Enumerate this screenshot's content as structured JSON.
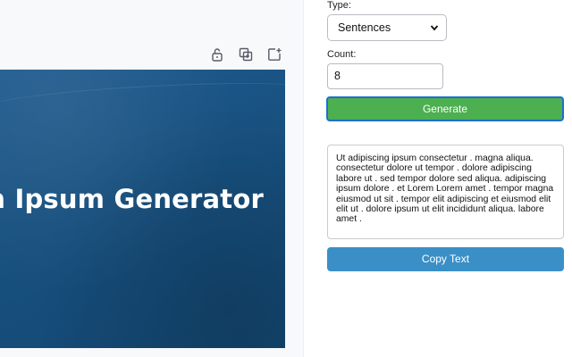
{
  "canvas": {
    "title": "m Ipsum Generator",
    "toolbar": {
      "icons": [
        "unlock-icon",
        "duplicate-icon",
        "add-page-icon"
      ]
    },
    "colors": {
      "background": "#17507f",
      "text": "#ffffff"
    }
  },
  "panel": {
    "type_label": "Type:",
    "type_value": "Sentences",
    "count_label": "Count:",
    "count_value": "8",
    "generate_label": "Generate",
    "output_text": "Ut adipiscing ipsum consectetur . magna aliqua. consectetur dolore ut tempor . dolore adipiscing labore ut . sed tempor dolore sed aliqua. adipiscing ipsum dolore . et Lorem Lorem amet . tempor magna eiusmod ut sit . tempor elit adipiscing et eiusmod elit elit ut . dolore ipsum ut elit incididunt aliqua. labore amet .",
    "copy_label": "Copy Text",
    "colors": {
      "generate": "#4caf50",
      "copy": "#3a8fc7",
      "focus_ring": "#1d6fd1"
    }
  }
}
